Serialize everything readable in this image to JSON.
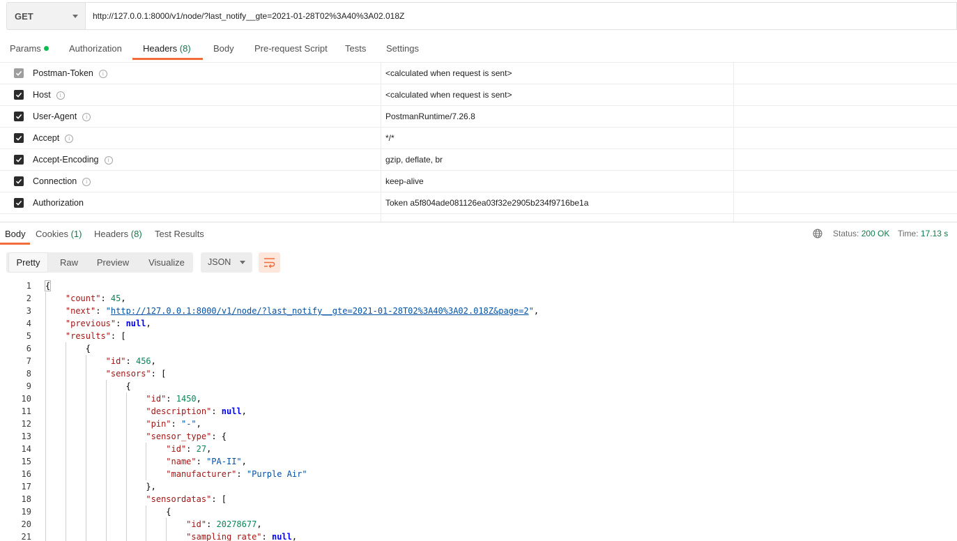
{
  "request": {
    "method": "GET",
    "url": "http://127.0.0.1:8000/v1/node/?last_notify__gte=2021-01-28T02%3A40%3A02.018Z"
  },
  "request_tabs": [
    {
      "label": "Params",
      "count": ""
    },
    {
      "label": "Authorization",
      "count": ""
    },
    {
      "label": "Headers",
      "count": "(8)"
    },
    {
      "label": "Body",
      "count": ""
    },
    {
      "label": "Pre-request Script",
      "count": ""
    },
    {
      "label": "Tests",
      "count": ""
    },
    {
      "label": "Settings",
      "count": ""
    }
  ],
  "headers": [
    {
      "key": "Postman-Token",
      "value": "<calculated when request is sent>",
      "info": "i"
    },
    {
      "key": "Host",
      "value": "<calculated when request is sent>",
      "info": "i"
    },
    {
      "key": "User-Agent",
      "value": "PostmanRuntime/7.26.8",
      "info": "i"
    },
    {
      "key": "Accept",
      "value": "*/*",
      "info": "i"
    },
    {
      "key": "Accept-Encoding",
      "value": "gzip, deflate, br",
      "info": "i"
    },
    {
      "key": "Connection",
      "value": "keep-alive",
      "info": "i"
    },
    {
      "key": "Authorization",
      "value": "Token a5f804ade081126ea03f32e2905b234f9716be1a",
      "info": ""
    }
  ],
  "response_tabs": [
    {
      "label": "Body",
      "count": ""
    },
    {
      "label": "Cookies",
      "count": "(1)"
    },
    {
      "label": "Headers",
      "count": "(8)"
    },
    {
      "label": "Test Results",
      "count": ""
    }
  ],
  "response_status": {
    "status_label": "Status:",
    "status_value": "200 OK",
    "time_label": "Time:",
    "time_value": "17.13 s"
  },
  "view_modes": [
    "Pretty",
    "Raw",
    "Preview",
    "Visualize"
  ],
  "format": "JSON",
  "code_lines": [
    {
      "n": "1",
      "indent": 0,
      "parts": [
        [
          "p",
          "{"
        ]
      ]
    },
    {
      "n": "2",
      "indent": 1,
      "parts": [
        [
          "k",
          "\"count\""
        ],
        [
          "p",
          ": "
        ],
        [
          "n",
          "45"
        ],
        [
          "p",
          ","
        ]
      ]
    },
    {
      "n": "3",
      "indent": 1,
      "parts": [
        [
          "k",
          "\"next\""
        ],
        [
          "p",
          ": "
        ],
        [
          "s",
          "\""
        ],
        [
          "u",
          "http://127.0.0.1:8000/v1/node/?last_notify__gte=2021-01-28T02%3A40%3A02.018Z&page=2"
        ],
        [
          "s",
          "\""
        ],
        [
          "p",
          ","
        ]
      ]
    },
    {
      "n": "4",
      "indent": 1,
      "parts": [
        [
          "k",
          "\"previous\""
        ],
        [
          "p",
          ": "
        ],
        [
          "b",
          "null"
        ],
        [
          "p",
          ","
        ]
      ]
    },
    {
      "n": "5",
      "indent": 1,
      "parts": [
        [
          "k",
          "\"results\""
        ],
        [
          "p",
          ": ["
        ]
      ]
    },
    {
      "n": "6",
      "indent": 2,
      "parts": [
        [
          "p",
          "{"
        ]
      ]
    },
    {
      "n": "7",
      "indent": 3,
      "parts": [
        [
          "k",
          "\"id\""
        ],
        [
          "p",
          ": "
        ],
        [
          "n",
          "456"
        ],
        [
          "p",
          ","
        ]
      ]
    },
    {
      "n": "8",
      "indent": 3,
      "parts": [
        [
          "k",
          "\"sensors\""
        ],
        [
          "p",
          ": ["
        ]
      ]
    },
    {
      "n": "9",
      "indent": 4,
      "parts": [
        [
          "p",
          "{"
        ]
      ]
    },
    {
      "n": "10",
      "indent": 5,
      "parts": [
        [
          "k",
          "\"id\""
        ],
        [
          "p",
          ": "
        ],
        [
          "n",
          "1450"
        ],
        [
          "p",
          ","
        ]
      ]
    },
    {
      "n": "11",
      "indent": 5,
      "parts": [
        [
          "k",
          "\"description\""
        ],
        [
          "p",
          ": "
        ],
        [
          "b",
          "null"
        ],
        [
          "p",
          ","
        ]
      ]
    },
    {
      "n": "12",
      "indent": 5,
      "parts": [
        [
          "k",
          "\"pin\""
        ],
        [
          "p",
          ": "
        ],
        [
          "s",
          "\"-\""
        ],
        [
          "p",
          ","
        ]
      ]
    },
    {
      "n": "13",
      "indent": 5,
      "parts": [
        [
          "k",
          "\"sensor_type\""
        ],
        [
          "p",
          ": {"
        ]
      ]
    },
    {
      "n": "14",
      "indent": 6,
      "parts": [
        [
          "k",
          "\"id\""
        ],
        [
          "p",
          ": "
        ],
        [
          "n",
          "27"
        ],
        [
          "p",
          ","
        ]
      ]
    },
    {
      "n": "15",
      "indent": 6,
      "parts": [
        [
          "k",
          "\"name\""
        ],
        [
          "p",
          ": "
        ],
        [
          "s",
          "\"PA-II\""
        ],
        [
          "p",
          ","
        ]
      ]
    },
    {
      "n": "16",
      "indent": 6,
      "parts": [
        [
          "k",
          "\"manufacturer\""
        ],
        [
          "p",
          ": "
        ],
        [
          "s",
          "\"Purple Air\""
        ]
      ]
    },
    {
      "n": "17",
      "indent": 5,
      "parts": [
        [
          "p",
          "},"
        ]
      ]
    },
    {
      "n": "18",
      "indent": 5,
      "parts": [
        [
          "k",
          "\"sensordatas\""
        ],
        [
          "p",
          ": ["
        ]
      ]
    },
    {
      "n": "19",
      "indent": 6,
      "parts": [
        [
          "p",
          "{"
        ]
      ]
    },
    {
      "n": "20",
      "indent": 7,
      "parts": [
        [
          "k",
          "\"id\""
        ],
        [
          "p",
          ": "
        ],
        [
          "n",
          "20278677"
        ],
        [
          "p",
          ","
        ]
      ]
    },
    {
      "n": "21",
      "indent": 7,
      "parts": [
        [
          "k",
          "\"sampling_rate\""
        ],
        [
          "p",
          ": "
        ],
        [
          "b",
          "null"
        ],
        [
          "p",
          ","
        ]
      ]
    }
  ]
}
